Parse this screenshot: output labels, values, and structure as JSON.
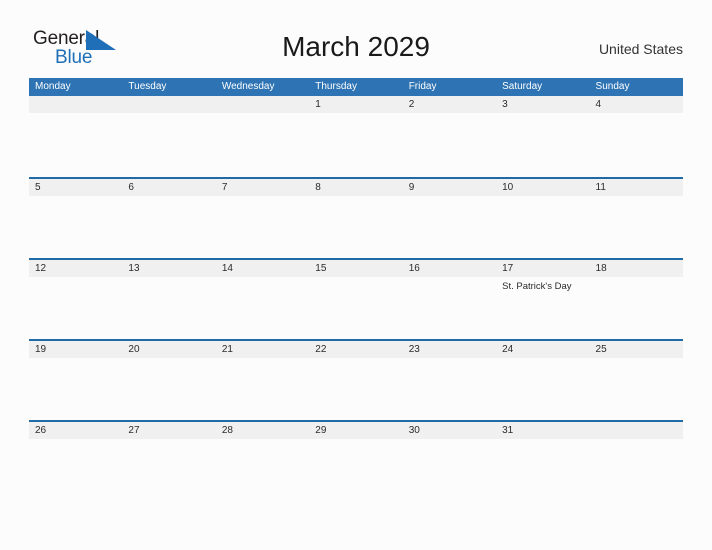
{
  "brand": {
    "name_part1": "General",
    "name_part2": "Blue",
    "triangle_icon": "triangle-right-icon",
    "color_dark": "#231F20",
    "color_blue": "#1F6FB8"
  },
  "header": {
    "title": "March 2029",
    "region": "United States"
  },
  "theme": {
    "header_blue": "#2E73B3",
    "row_border_blue": "#1F6BA8",
    "band_gray": "#F0F0F0",
    "page_background": "#FCFCFC",
    "text_color": "#2B2B2B"
  },
  "calendar": {
    "month": "March",
    "year": "2029",
    "weekdays": [
      "Monday",
      "Tuesday",
      "Wednesday",
      "Thursday",
      "Friday",
      "Saturday",
      "Sunday"
    ],
    "weeks": [
      [
        {
          "day": "",
          "events": []
        },
        {
          "day": "",
          "events": []
        },
        {
          "day": "",
          "events": []
        },
        {
          "day": "1",
          "events": []
        },
        {
          "day": "2",
          "events": []
        },
        {
          "day": "3",
          "events": []
        },
        {
          "day": "4",
          "events": []
        }
      ],
      [
        {
          "day": "5",
          "events": []
        },
        {
          "day": "6",
          "events": []
        },
        {
          "day": "7",
          "events": []
        },
        {
          "day": "8",
          "events": []
        },
        {
          "day": "9",
          "events": []
        },
        {
          "day": "10",
          "events": []
        },
        {
          "day": "11",
          "events": []
        }
      ],
      [
        {
          "day": "12",
          "events": []
        },
        {
          "day": "13",
          "events": []
        },
        {
          "day": "14",
          "events": []
        },
        {
          "day": "15",
          "events": []
        },
        {
          "day": "16",
          "events": []
        },
        {
          "day": "17",
          "events": [
            "St. Patrick's Day"
          ]
        },
        {
          "day": "18",
          "events": []
        }
      ],
      [
        {
          "day": "19",
          "events": []
        },
        {
          "day": "20",
          "events": []
        },
        {
          "day": "21",
          "events": []
        },
        {
          "day": "22",
          "events": []
        },
        {
          "day": "23",
          "events": []
        },
        {
          "day": "24",
          "events": []
        },
        {
          "day": "25",
          "events": []
        }
      ],
      [
        {
          "day": "26",
          "events": []
        },
        {
          "day": "27",
          "events": []
        },
        {
          "day": "28",
          "events": []
        },
        {
          "day": "29",
          "events": []
        },
        {
          "day": "30",
          "events": []
        },
        {
          "day": "31",
          "events": []
        },
        {
          "day": "",
          "events": []
        }
      ]
    ]
  }
}
